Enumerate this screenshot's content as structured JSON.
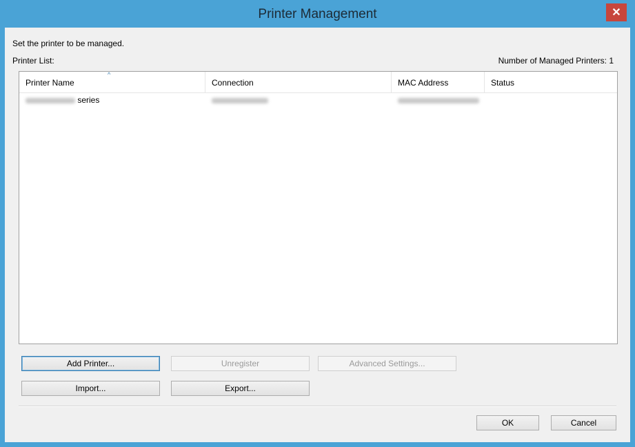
{
  "window": {
    "title": "Printer Management",
    "close_glyph": "✕"
  },
  "instruction": "Set the printer to be managed.",
  "printer_list_label": "Printer List:",
  "managed_count": "Number of Managed Printers: 1",
  "list": {
    "columns": [
      "Printer Name",
      "Connection",
      "MAC Address",
      "Status"
    ],
    "sort_indicator": "^",
    "rows": [
      {
        "printer_name_suffix": "series",
        "connection": "",
        "mac_address": "",
        "status": ""
      }
    ]
  },
  "buttons": {
    "add_printer": "Add Printer...",
    "unregister": "Unregister",
    "advanced_settings": "Advanced Settings...",
    "import": "Import...",
    "export": "Export...",
    "ok": "OK",
    "cancel": "Cancel"
  },
  "colors": {
    "titlebar": "#4aa3d6",
    "close_button": "#c7463c",
    "dialog_bg": "#f0f0f0",
    "default_button_border": "#3c7fb1"
  },
  "icons": {
    "close": "close-icon",
    "sort": "sort-ascending-icon"
  }
}
